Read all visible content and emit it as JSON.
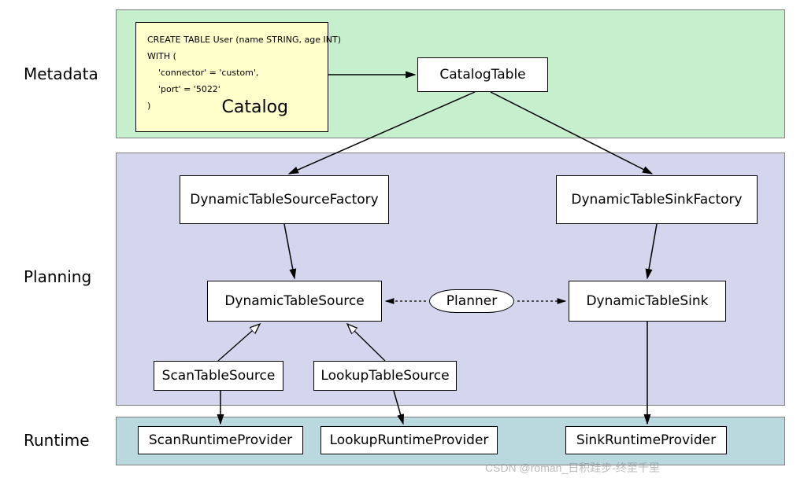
{
  "labels": {
    "metadata": "Metadata",
    "planning": "Planning",
    "runtime": "Runtime"
  },
  "catalog": {
    "line1": "CREATE TABLE User (name STRING, age INT)",
    "line2": "WITH (",
    "line3": "    'connector' = 'custom',",
    "line4": "    'port' = '5022'",
    "line5": ")",
    "title": "Catalog"
  },
  "nodes": {
    "catalogTable": "CatalogTable",
    "sourceFactory": "DynamicTableSourceFactory",
    "sinkFactory": "DynamicTableSinkFactory",
    "tableSource": "DynamicTableSource",
    "tableSink": "DynamicTableSink",
    "planner": "Planner",
    "scanTableSource": "ScanTableSource",
    "lookupTableSource": "LookupTableSource",
    "scanRuntimeProvider": "ScanRuntimeProvider",
    "lookupRuntimeProvider": "LookupRuntimeProvider",
    "sinkRuntimeProvider": "SinkRuntimeProvider"
  },
  "watermark": "CSDN @roman_日积跬步-终至千里"
}
